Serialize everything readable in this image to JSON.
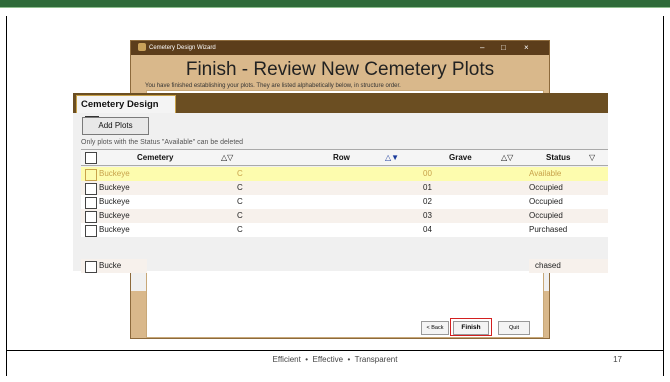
{
  "wizard": {
    "window_title": "Cemetery Design Wizard",
    "controls": [
      "–",
      "□",
      "×"
    ],
    "heading": "Finish - Review New Cemetery Plots",
    "subtitle": "You have finished establishing your plots. They are listed alphabetically below, in structure order.",
    "back_label": "< Back",
    "finish_label": "Finish",
    "quit_label": "Quit"
  },
  "panel": {
    "tab_label": "Cemetery Design",
    "tab_close": "✕",
    "add_plots_label": "Add Plots",
    "note": "Only plots with the Status \"Available\" can be deleted"
  },
  "table": {
    "columns": [
      {
        "label": "Cemetery",
        "sort": "△▽"
      },
      {
        "label": "Row",
        "sort": "△▼"
      },
      {
        "label": "Grave",
        "sort": "△▽"
      },
      {
        "label": "Status",
        "sort": "▽"
      }
    ],
    "rows": [
      {
        "cemetery": "Buckeye",
        "row": "C",
        "grave": "00",
        "status": "Available"
      },
      {
        "cemetery": "Buckeye",
        "row": "C",
        "grave": "01",
        "status": "Occupied"
      },
      {
        "cemetery": "Buckeye",
        "row": "C",
        "grave": "02",
        "status": "Occupied"
      },
      {
        "cemetery": "Buckeye",
        "row": "C",
        "grave": "03",
        "status": "Occupied"
      },
      {
        "cemetery": "Buckeye",
        "row": "C",
        "grave": "04",
        "status": "Purchased"
      },
      {
        "cemetery": "Bucke",
        "row": "",
        "grave": "",
        "status": "chased"
      }
    ]
  },
  "footer": {
    "tagline": "Efficient  •  Effective  •  Transparent",
    "page_number": "17"
  },
  "colors": {
    "wizard_title": "#5c3d1b",
    "wizard_header": "#d9b88b",
    "panel_tabbar": "#6b4e22",
    "selected_row": "#fdfcae",
    "finish_highlight": "#d32020",
    "slide_topbar": "#2f6b3a"
  }
}
